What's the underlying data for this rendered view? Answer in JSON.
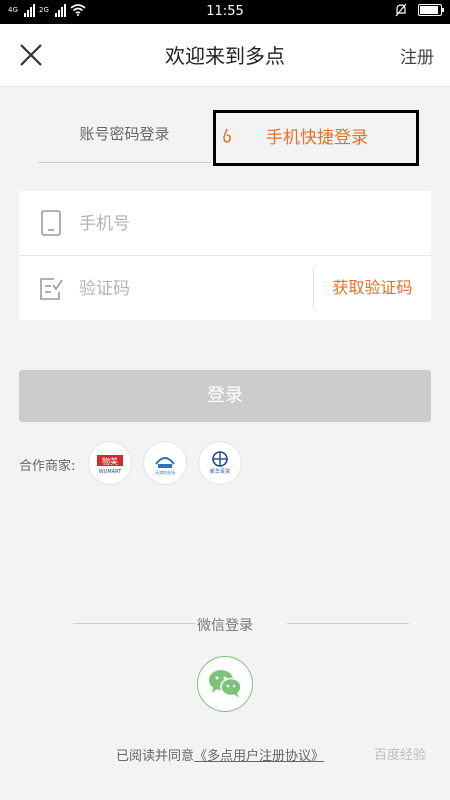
{
  "status_bar": {
    "time": "11:55",
    "network_left": "4G",
    "network_right": "2G"
  },
  "nav": {
    "title": "欢迎来到多点",
    "register": "注册"
  },
  "tabs": {
    "password_login": "账号密码登录",
    "quick_login": "手机快捷登录"
  },
  "form": {
    "phone_placeholder": "手机号",
    "code_placeholder": "验证码",
    "get_code": "获取验证码"
  },
  "login_button": "登录",
  "partners": {
    "label": "合作商家:",
    "items": [
      {
        "name": "WUMART",
        "icon": "wumart-logo"
      },
      {
        "name": "天津劝业场",
        "icon": "partner-2-logo"
      },
      {
        "name": "新华百货",
        "icon": "xinhua-logo"
      }
    ]
  },
  "wechat": {
    "label": "微信登录",
    "icon": "wechat-icon"
  },
  "agreement": {
    "prefix": "已阅读并同意",
    "link": "《多点用户注册协议》"
  },
  "watermark": "百度经验",
  "colors": {
    "accent": "#e5722a",
    "disabled_button": "#cccccc",
    "background": "#f3f3f3",
    "wechat_green": "#7cc37a"
  }
}
